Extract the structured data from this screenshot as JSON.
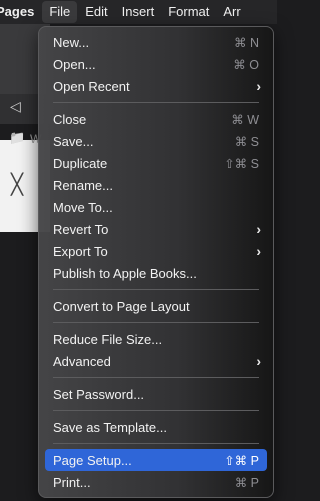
{
  "menubar": {
    "app": "Pages",
    "items": [
      "File",
      "Edit",
      "Insert",
      "Format",
      "Arr"
    ]
  },
  "background": {
    "back_glyph": "◁",
    "folder_glyph": "📁",
    "folder_letter": "W",
    "close_glyph": "╳"
  },
  "menu": {
    "items": [
      {
        "label": "New...",
        "shortcut": "⌘ N"
      },
      {
        "label": "Open...",
        "shortcut": "⌘ O"
      },
      {
        "label": "Open Recent",
        "arrow": "›"
      },
      {
        "label": "Close",
        "shortcut": "⌘ W"
      },
      {
        "label": "Save...",
        "shortcut": "⌘ S"
      },
      {
        "label": "Duplicate",
        "shortcut": "⇧⌘ S"
      },
      {
        "label": "Rename..."
      },
      {
        "label": "Move To..."
      },
      {
        "label": "Revert To",
        "arrow": "›"
      },
      {
        "label": "Export To",
        "arrow": "›"
      },
      {
        "label": "Publish to Apple Books..."
      },
      {
        "label": "Convert to Page Layout"
      },
      {
        "label": "Reduce File Size..."
      },
      {
        "label": "Advanced",
        "arrow": "›"
      },
      {
        "label": "Set Password..."
      },
      {
        "label": "Save as Template..."
      },
      {
        "label": "Page Setup...",
        "shortcut": "⇧⌘ P"
      },
      {
        "label": "Print...",
        "shortcut": "⌘ P"
      }
    ]
  }
}
